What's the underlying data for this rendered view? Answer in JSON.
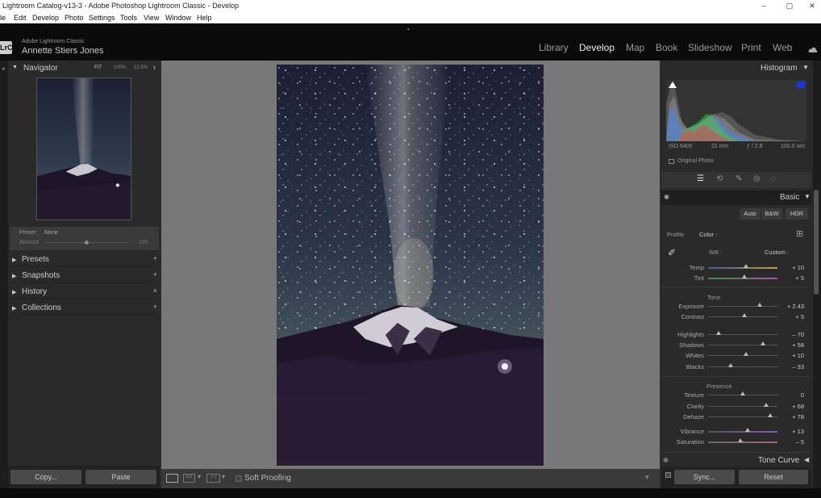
{
  "window": {
    "title": "Lightroom Catalog-v13-3 - Adobe Photoshop Lightroom Classic - Develop",
    "controls": [
      "–",
      "▢",
      "✕"
    ]
  },
  "menu": [
    "le",
    "Edit",
    "Develop",
    "Photo",
    "Settings",
    "Tools",
    "View",
    "Window",
    "Help"
  ],
  "identity": {
    "logo": "LrC",
    "app": "Adobe Lightroom Classic",
    "user": "Annette Stiers Jones"
  },
  "modules": [
    "Library",
    "Develop",
    "Map",
    "Book",
    "Slideshow",
    "Print",
    "Web"
  ],
  "left": {
    "navigator": {
      "title": "Navigator",
      "fit": "FIT",
      "z1": "100%",
      "z2": "12.5%"
    },
    "preset": {
      "label": "Preset :",
      "value": "None",
      "amount_label": "Amount",
      "amount_value": "100"
    },
    "sections": [
      {
        "label": "Presets",
        "action": "+"
      },
      {
        "label": "Snapshots",
        "action": "+"
      },
      {
        "label": "History",
        "action": "×"
      },
      {
        "label": "Collections",
        "action": "+"
      }
    ],
    "copy": "Copy...",
    "paste": "Paste"
  },
  "toolbar": {
    "soft_proofing": "Soft Proofing"
  },
  "right": {
    "histogram": {
      "title": "Histogram",
      "iso": "ISO 6400",
      "focal": "21 mm",
      "aperture": "ƒ / 2.8",
      "shutter": "100.0 sec",
      "original": "Original Photo"
    },
    "basic": {
      "title": "Basic",
      "auto": "Auto",
      "bw": "B&W",
      "hdr": "HDR",
      "profile_label": "Profile",
      "profile_value": "Color :",
      "wb_label": "WB :",
      "wb_value": "Custom :",
      "tone_title": "Tone",
      "presence_title": "Presence"
    },
    "sliders": [
      {
        "name": "Temp",
        "value": "+ 10",
        "pos": 0.55
      },
      {
        "name": "Tint",
        "value": "+ 5",
        "pos": 0.52
      },
      {
        "name": "Exposure",
        "value": "+ 2.43",
        "pos": 0.74
      },
      {
        "name": "Contrast",
        "value": "+ 5",
        "pos": 0.52
      },
      {
        "name": "Highlights",
        "value": "– 70",
        "pos": 0.15
      },
      {
        "name": "Shadows",
        "value": "+ 58",
        "pos": 0.79
      },
      {
        "name": "Whites",
        "value": "+ 10",
        "pos": 0.55
      },
      {
        "name": "Blacks",
        "value": "– 33",
        "pos": 0.33
      },
      {
        "name": "Texture",
        "value": "0",
        "pos": 0.5
      },
      {
        "name": "Clarity",
        "value": "+ 68",
        "pos": 0.84
      },
      {
        "name": "Dehaze",
        "value": "+ 78",
        "pos": 0.89
      },
      {
        "name": "Vibrance",
        "value": "+ 13",
        "pos": 0.57
      },
      {
        "name": "Saturation",
        "value": "– 5",
        "pos": 0.47
      }
    ],
    "tone_curve": "Tone Curve",
    "sync": "Sync...",
    "reset": "Reset"
  }
}
